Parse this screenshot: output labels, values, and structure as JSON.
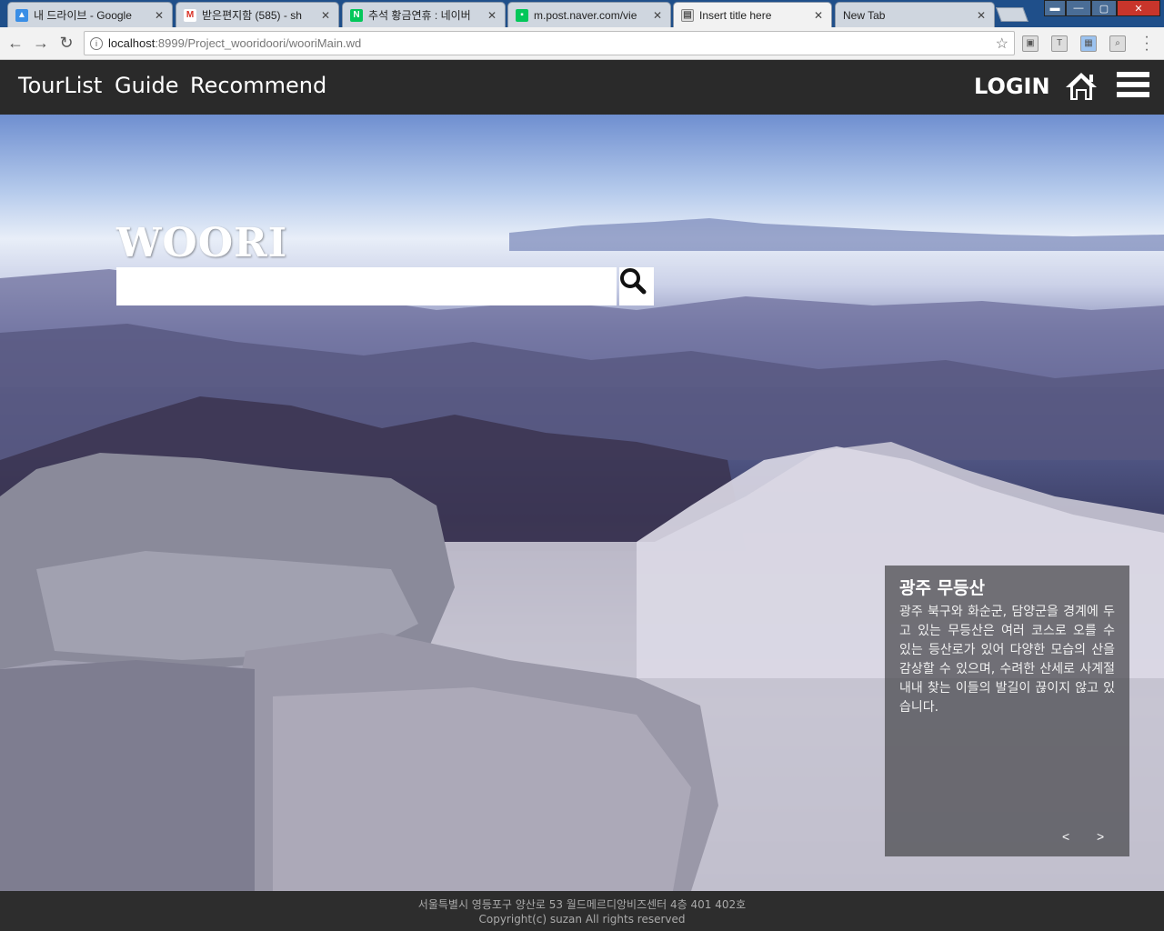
{
  "browser": {
    "tabs": [
      {
        "label": "내 드라이브 - Google",
        "icon": "google-drive-icon",
        "color": "#3a8ee6"
      },
      {
        "label": "받은편지함 (585) - sh",
        "icon": "gmail-icon",
        "color": "#d93025"
      },
      {
        "label": "추석 황금연휴 : 네이버",
        "icon": "naver-icon",
        "color": "#03c75a"
      },
      {
        "label": "m.post.naver.com/vie",
        "icon": "naver-post-icon",
        "color": "#03c75a"
      },
      {
        "label": "Insert title here",
        "icon": "page-icon",
        "color": "#888888"
      },
      {
        "label": "New Tab",
        "icon": "",
        "color": ""
      }
    ],
    "url_host": "localhost",
    "url_path": ":8999/Project_wooridoori/wooriMain.wd"
  },
  "nav": {
    "links": [
      "TourList",
      "Guide",
      "Recommend"
    ],
    "login": "LOGIN"
  },
  "hero": {
    "logo": "WOORI",
    "search_placeholder": "",
    "info_title": "광주 무등산",
    "info_desc": "광주 북구와 화순군, 담양군을 경계에 두고 있는 무등산은 여러 코스로 오를 수 있는 등산로가 있어 다양한 모습의 산을 감상할 수 있으며, 수려한 산세로 사계절 내내 찾는 이들의 발길이 끊이지 않고 있습니다.",
    "prev": "<",
    "next": ">"
  },
  "footer": {
    "address": "서울특별시 영등포구 양산로 53 월드메르디앙비즈센터 4층 401 402호",
    "copyright": "Copyright(c) suzan All rights reserved"
  }
}
